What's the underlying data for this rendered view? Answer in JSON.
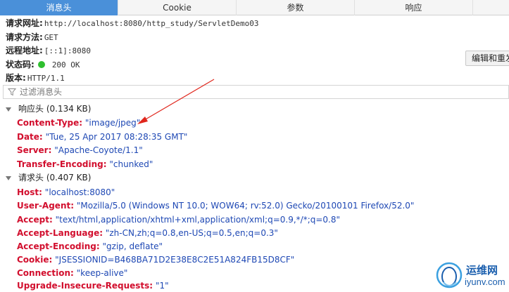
{
  "tabs": [
    {
      "label": "消息头"
    },
    {
      "label": "Cookie"
    },
    {
      "label": "参数"
    },
    {
      "label": "响应"
    }
  ],
  "summary": {
    "url_label": "请求网址:",
    "url": "http://localhost:8080/http_study/ServletDemo03",
    "method_label": "请求方法:",
    "method": "GET",
    "remote_label": "远程地址:",
    "remote": "[::1]:8080",
    "status_label": "状态码:",
    "status": "200 OK",
    "status_color": "#2fbf2f",
    "version_label": "版本:",
    "version": "HTTP/1.1"
  },
  "edit_button": {
    "label": "编辑和重发"
  },
  "filter": {
    "placeholder": "过滤消息头",
    "icon": "filter-icon"
  },
  "response_headers": {
    "title": "响应头 (0.134 KB)",
    "items": [
      {
        "name": "Content-Type:",
        "value": "\"image/jpeg\""
      },
      {
        "name": "Date:",
        "value": "\"Tue, 25 Apr 2017 08:28:35 GMT\""
      },
      {
        "name": "Server:",
        "value": "\"Apache-Coyote/1.1\""
      },
      {
        "name": "Transfer-Encoding:",
        "value": "\"chunked\""
      }
    ]
  },
  "request_headers": {
    "title": "请求头 (0.407 KB)",
    "items": [
      {
        "name": "Host:",
        "value": "\"localhost:8080\""
      },
      {
        "name": "User-Agent:",
        "value": "\"Mozilla/5.0 (Windows NT 10.0; WOW64; rv:52.0) Gecko/20100101 Firefox/52.0\""
      },
      {
        "name": "Accept:",
        "value": "\"text/html,application/xhtml+xml,application/xml;q=0.9,*/*;q=0.8\""
      },
      {
        "name": "Accept-Language:",
        "value": "\"zh-CN,zh;q=0.8,en-US;q=0.5,en;q=0.3\""
      },
      {
        "name": "Accept-Encoding:",
        "value": "\"gzip, deflate\""
      },
      {
        "name": "Cookie:",
        "value": "\"JSESSIONID=B468BA71D2E38E8C2E51A824FB15D8CF\""
      },
      {
        "name": "Connection:",
        "value": "\"keep-alive\""
      },
      {
        "name": "Upgrade-Insecure-Requests:",
        "value": "\"1\""
      }
    ]
  },
  "colors": {
    "active_tab": "#4a90d9",
    "header_name": "#d20f2e",
    "header_value": "#1e48b4",
    "annotation_arrow": "#e0261c"
  },
  "watermark": {
    "name_cn": "运维网",
    "url": "iyunv.com"
  }
}
